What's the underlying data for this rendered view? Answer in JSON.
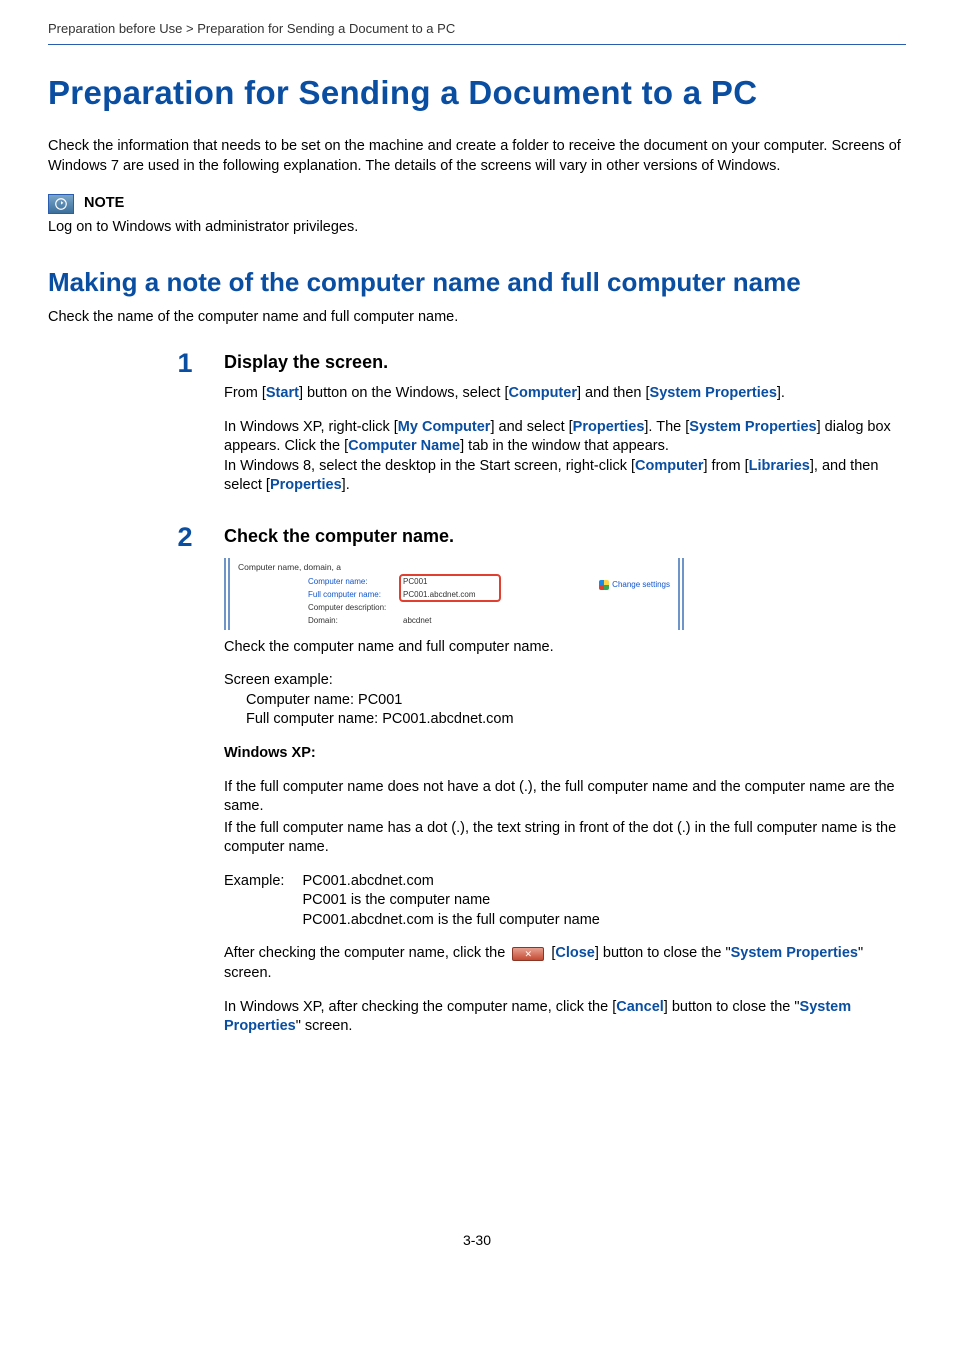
{
  "breadcrumb": "Preparation before Use > Preparation for Sending a Document to a PC",
  "page_title": "Preparation for Sending a Document to a PC",
  "intro": "Check the information that needs to be set on the machine and create a folder to receive the document on your computer. Screens of Windows 7 are used in the following explanation. The details of the screens will vary in other versions of Windows.",
  "note": {
    "label": "NOTE",
    "text": "Log on to Windows with administrator privileges."
  },
  "section_title": "Making a note of the computer name and full computer name",
  "section_lead": "Check the name of the computer name and full computer name.",
  "step1": {
    "num": "1",
    "heading": "Display the screen.",
    "p1_a": "From [",
    "p1_b": "Start",
    "p1_c": "] button on the Windows, select [",
    "p1_d": "Computer",
    "p1_e": "] and then [",
    "p1_f": "System Properties",
    "p1_g": "].",
    "p2_a": "In Windows XP, right-click [",
    "p2_b": "My Computer",
    "p2_c": "] and select [",
    "p2_d": "Properties",
    "p2_e": "]. The [",
    "p2_f": "System Properties",
    "p2_g": "] dialog box appears. Click the [",
    "p2_h": "Computer Name",
    "p2_i": "] tab in the window that appears.",
    "p3_a": "In Windows 8, select the desktop in the Start screen, right-click [",
    "p3_b": "Computer",
    "p3_c": "] from [",
    "p3_d": "Libraries",
    "p3_e": "], and then select [",
    "p3_f": "Properties",
    "p3_g": "]."
  },
  "step2": {
    "num": "2",
    "heading": "Check the computer name.",
    "fig": {
      "top_label": "Computer name, domain, a",
      "row1_label": "Computer name:",
      "row1_val": "PC001",
      "row2_label": "Full computer name:",
      "row2_val": "PC001.abcdnet.com",
      "row3_label": "Computer description:",
      "row4_label": "Domain:",
      "row4_val": "abcdnet",
      "change": "Change settings"
    },
    "p1": "Check the computer name and full computer name.",
    "screen_example_label": "Screen example:",
    "screen_example_l1": "Computer name: PC001",
    "screen_example_l2": "Full computer name: PC001.abcdnet.com",
    "winxp_heading": "Windows XP:",
    "winxp_p1": "If the full computer name does not have a dot (.), the full computer name and the computer name are the same.",
    "winxp_p2": "If the full computer name has a dot (.), the text string in front of the dot (.) in the full computer name is the computer name.",
    "example_label": "Example:",
    "example_l1": "PC001.abcdnet.com",
    "example_l2": "PC001 is the computer name",
    "example_l3": "PC001.abcdnet.com is the full computer name",
    "close_a": "After checking the computer name, click the ",
    "close_b": " [",
    "close_c": "Close",
    "close_d": "] button to close the \"",
    "close_e": "System Properties",
    "close_f": "\" screen.",
    "cancel_a": "In Windows XP, after checking the computer name, click the [",
    "cancel_b": "Cancel",
    "cancel_c": "] button to close the \"",
    "cancel_d": "System Properties",
    "cancel_e": "\" screen."
  },
  "page_number": "3-30"
}
